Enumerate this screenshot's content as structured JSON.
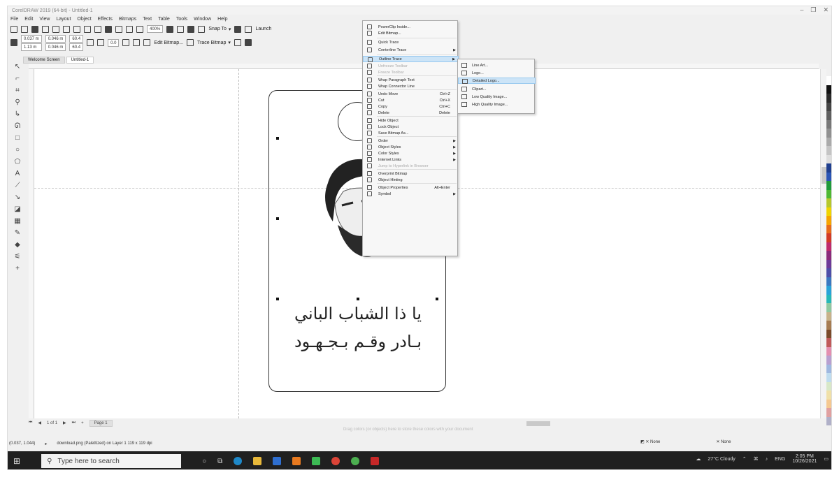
{
  "window": {
    "title": "CorelDRAW 2019 (64-bit) - Untitled-1"
  },
  "menubar": [
    "File",
    "Edit",
    "View",
    "Layout",
    "Object",
    "Effects",
    "Bitmaps",
    "Text",
    "Table",
    "Tools",
    "Window",
    "Help"
  ],
  "toolbar1": {
    "zoom": "400%",
    "snap_label": "Snap To",
    "launch_label": "Launch"
  },
  "toolbar2": {
    "x": "0.037 m",
    "y": "1.13 m",
    "w": "0.046 m",
    "h": "0.046 m",
    "sx": "60.4",
    "sy": "60.4",
    "angle": "0.0",
    "edit_bitmap": "Edit Bitmap...",
    "trace_bitmap": "Trace Bitmap"
  },
  "tabs": [
    "Welcome Screen",
    "Untitled-1"
  ],
  "artwork": {
    "line1": "يا ذا الشباب الباني",
    "line2": "بـادر وقـم بـجـهـود"
  },
  "context_menu": {
    "items": [
      {
        "label": "PowerClip Inside...",
        "shortcut": ""
      },
      {
        "label": "Edit Bitmap...",
        "shortcut": ""
      },
      {
        "label": "Quick Trace",
        "shortcut": ""
      },
      {
        "label": "Centerline Trace",
        "shortcut": "",
        "sub": true
      },
      {
        "label": "Outline Trace",
        "shortcut": "",
        "sub": true,
        "highlight": true
      },
      {
        "label": "Unfreeze Toolbar",
        "shortcut": "",
        "disabled": true
      },
      {
        "label": "Freeze Toolbar",
        "shortcut": "",
        "disabled": true
      },
      {
        "label": "Wrap Paragraph Text",
        "shortcut": ""
      },
      {
        "label": "Wrap Connector Line",
        "shortcut": ""
      },
      {
        "label": "Undo Move",
        "shortcut": "Ctrl+Z"
      },
      {
        "label": "Cut",
        "shortcut": "Ctrl+X"
      },
      {
        "label": "Copy",
        "shortcut": "Ctrl+C"
      },
      {
        "label": "Delete",
        "shortcut": "Delete"
      },
      {
        "label": "Hide Object",
        "shortcut": ""
      },
      {
        "label": "Lock Object",
        "shortcut": ""
      },
      {
        "label": "Save Bitmap As...",
        "shortcut": ""
      },
      {
        "label": "Order",
        "shortcut": "",
        "sub": true
      },
      {
        "label": "Object Styles",
        "shortcut": "",
        "sub": true
      },
      {
        "label": "Color Styles",
        "shortcut": "",
        "sub": true
      },
      {
        "label": "Internet Links",
        "shortcut": "",
        "sub": true
      },
      {
        "label": "Jump to Hyperlink in Browser",
        "shortcut": "",
        "disabled": true
      },
      {
        "label": "Overprint Bitmap",
        "shortcut": ""
      },
      {
        "label": "Object Hinting",
        "shortcut": ""
      },
      {
        "label": "Object Properties",
        "shortcut": "Alt+Enter"
      },
      {
        "label": "Symbol",
        "shortcut": "",
        "sub": true
      }
    ]
  },
  "submenu": {
    "items": [
      "Line Art...",
      "Logo...",
      "Detailed Logo...",
      "Clipart...",
      "Low Quality Image...",
      "High Quality Image..."
    ]
  },
  "bottom": {
    "page_nav": "1 of 1",
    "page_tab": "Page 1",
    "hint": "Drag colors (or objects) here to store these colors with your document"
  },
  "status": {
    "coords": "(0.037, 1.044)",
    "file_info": "download.png (Palettized) on Layer 1 119 x 119 dpi",
    "fill1": "None",
    "fill2": "None"
  },
  "taskbar": {
    "search_placeholder": "Type here to search",
    "weather": "27°C  Cloudy",
    "lang": "ENG",
    "time": "2:05 PM",
    "date": "10/26/2021"
  },
  "palette_colors": [
    "#ffffff",
    "#111111",
    "#2a2a2a",
    "#444444",
    "#5e5e5e",
    "#777777",
    "#909090",
    "#aaaaaa",
    "#c4c4c4",
    "#dddddd",
    "#1f3f8f",
    "#2a55b5",
    "#1f9a3b",
    "#4fb833",
    "#b6c72d",
    "#f0d400",
    "#f6a400",
    "#e86b1a",
    "#d23a26",
    "#bf2a6b",
    "#8b2a7a",
    "#6d3a98",
    "#4d4ea8",
    "#3a78c0",
    "#29a3d8",
    "#26b8b8",
    "#8fc8a0",
    "#c7b28a",
    "#a67c52",
    "#7a4a2a",
    "#c05a5a",
    "#e48fb0",
    "#b8a0d0",
    "#9fb8e0",
    "#bfdcef",
    "#d8e8c8",
    "#f0e0a8",
    "#f5c890",
    "#e0a0a0",
    "#b0b0c8"
  ]
}
